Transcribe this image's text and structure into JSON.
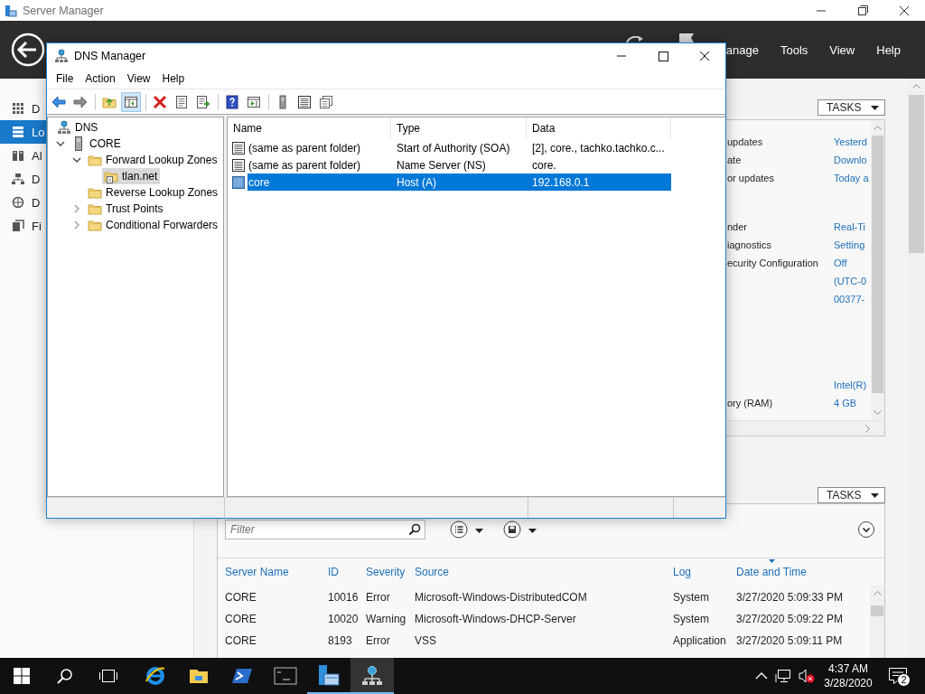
{
  "server_manager": {
    "title": "Server Manager",
    "header_menu": [
      "anage",
      "Tools",
      "View",
      "Help"
    ],
    "sidebar": [
      {
        "label": "D",
        "kind": "dashboard",
        "selected": false
      },
      {
        "label": "Lo",
        "kind": "server",
        "selected": true
      },
      {
        "label": "Al",
        "kind": "servers",
        "selected": false
      },
      {
        "label": "D",
        "kind": "dhcp",
        "selected": false
      },
      {
        "label": "D",
        "kind": "dns",
        "selected": false
      },
      {
        "label": "Fi",
        "kind": "files",
        "selected": false
      }
    ],
    "properties": {
      "tasks": "TASKS",
      "groups": [
        [
          {
            "label": "updates",
            "value": "Yesterd"
          },
          {
            "label": "ate",
            "value": "Downlo"
          },
          {
            "label": "or updates",
            "value": "Today a"
          }
        ],
        [
          {
            "label": "nder",
            "value": "Real-Ti"
          },
          {
            "label": "iagnostics",
            "value": "Setting"
          },
          {
            "label": "ecurity Configuration",
            "value": "Off"
          },
          {
            "value": "(UTC-0"
          },
          {
            "value": "00377-"
          }
        ],
        [
          {
            "value": "Intel(R)"
          },
          {
            "label": "ory (RAM)",
            "value": "4 GB"
          }
        ]
      ]
    },
    "events": {
      "tasks": "TASKS",
      "filter": {
        "placeholder": "Filter"
      },
      "columns": [
        {
          "label": "Server Name",
          "sorted": false
        },
        {
          "label": "ID",
          "sorted": false
        },
        {
          "label": "Severity",
          "sorted": false
        },
        {
          "label": "Source",
          "sorted": false
        },
        {
          "label": "Log",
          "sorted": false
        },
        {
          "label": "Date and Time",
          "sorted": true
        }
      ],
      "rows": [
        [
          "CORE",
          "10016",
          "Error",
          "Microsoft-Windows-DistributedCOM",
          "System",
          "3/27/2020 5:09:33 PM"
        ],
        [
          "CORE",
          "10020",
          "Warning",
          "Microsoft-Windows-DHCP-Server",
          "System",
          "3/27/2020 5:09:22 PM"
        ],
        [
          "CORE",
          "8193",
          "Error",
          "VSS",
          "Application",
          "3/27/2020 5:09:11 PM"
        ]
      ]
    }
  },
  "dns_manager": {
    "title": "DNS Manager",
    "menu": [
      "File",
      "Action",
      "View",
      "Help"
    ],
    "toolbar": [
      {
        "kind": "back",
        "pressed": false
      },
      {
        "kind": "forward",
        "pressed": false
      },
      {
        "kind": "separator"
      },
      {
        "kind": "up",
        "pressed": false
      },
      {
        "kind": "tree",
        "pressed": true
      },
      {
        "kind": "separator"
      },
      {
        "kind": "delete",
        "pressed": false
      },
      {
        "kind": "properties",
        "pressed": false
      },
      {
        "kind": "export",
        "pressed": false
      },
      {
        "kind": "separator"
      },
      {
        "kind": "help",
        "pressed": false
      },
      {
        "kind": "run",
        "pressed": false
      },
      {
        "kind": "separator"
      },
      {
        "kind": "server",
        "pressed": false
      },
      {
        "kind": "list",
        "pressed": false
      },
      {
        "kind": "copy",
        "pressed": false
      }
    ],
    "tree": [
      {
        "label": "DNS",
        "kind": "root",
        "selected": false,
        "children": [
          {
            "label": "CORE",
            "kind": "server",
            "selected": false,
            "expanded": true,
            "children": [
              {
                "label": "Forward Lookup Zones",
                "kind": "folder",
                "selected": false,
                "expanded": true,
                "children": [
                  {
                    "label": "tlan.net",
                    "kind": "zone",
                    "selected": true
                  }
                ]
              },
              {
                "label": "Reverse Lookup Zones",
                "kind": "folder",
                "selected": false
              },
              {
                "label": "Trust Points",
                "kind": "folder",
                "selected": false,
                "expanded": false
              },
              {
                "label": "Conditional Forwarders",
                "kind": "folder",
                "selected": false,
                "expanded": false
              }
            ]
          }
        ]
      }
    ],
    "list": {
      "columns": [
        "Name",
        "Type",
        "Data"
      ],
      "rows": [
        {
          "name": "(same as parent folder)",
          "type": "Start of Authority (SOA)",
          "data": "[2], core., tachko.tachko.c...",
          "selected": false
        },
        {
          "name": "(same as parent folder)",
          "type": "Name Server (NS)",
          "data": "core.",
          "selected": false
        },
        {
          "name": "core",
          "type": "Host (A)",
          "data": "192.168.0.1",
          "selected": true
        }
      ]
    }
  },
  "taskbar": {
    "apps": [
      {
        "kind": "browser",
        "open": false,
        "active": false
      },
      {
        "kind": "folder",
        "open": false,
        "active": false
      },
      {
        "kind": "powershell",
        "open": false,
        "active": false
      },
      {
        "kind": "terminal",
        "open": false,
        "active": false
      },
      {
        "kind": "server-manager",
        "open": true,
        "active": false
      },
      {
        "kind": "dns",
        "open": true,
        "active": true
      }
    ],
    "time": "4:37 AM",
    "date": "3/28/2020",
    "notification_count": "2"
  }
}
